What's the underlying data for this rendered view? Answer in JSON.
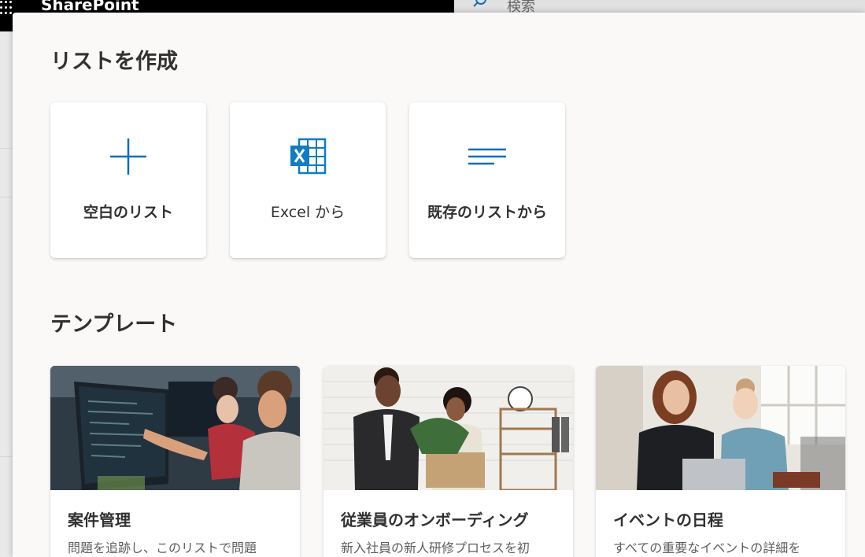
{
  "app": {
    "brand": "SharePoint",
    "search_placeholder": "検索"
  },
  "create_list": {
    "title": "リストを作成",
    "options": [
      {
        "label": "空白のリスト",
        "icon": "plus-icon"
      },
      {
        "label": "Excel から",
        "icon": "excel-icon"
      },
      {
        "label": "既存のリストから",
        "icon": "list-lines-icon"
      }
    ]
  },
  "templates": {
    "title": "テンプレート",
    "items": [
      {
        "title": "案件管理",
        "description": "問題を追跡し、このリストで問題"
      },
      {
        "title": "従業員のオンボーディング",
        "description": "新入社員の新人研修プロセスを初"
      },
      {
        "title": "イベントの日程",
        "description": "すべての重要なイベントの詳細を"
      }
    ]
  },
  "colors": {
    "accent": "#0f6cbd",
    "excel": "#107cc2"
  }
}
